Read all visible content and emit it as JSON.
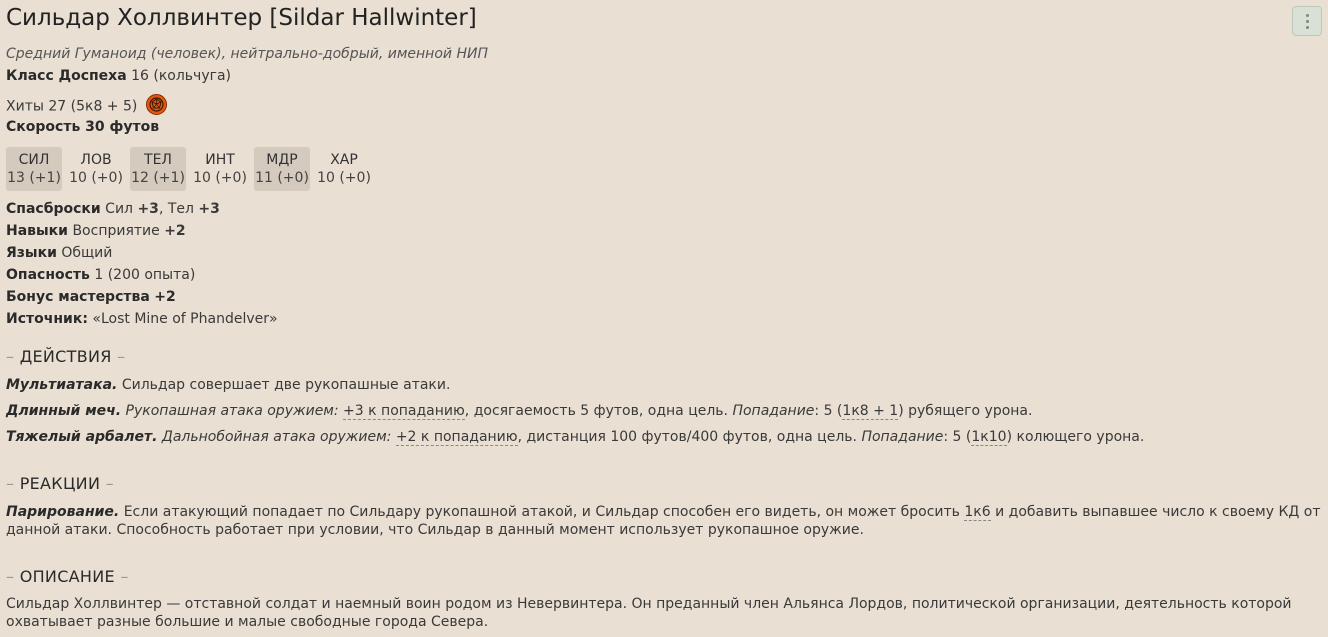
{
  "header": {
    "title": "Сильдар Холлвинтер [Sildar Hallwinter]"
  },
  "creature": {
    "subtitle": "Средний Гуманоид (человек), нейтрально-добрый, именной НИП",
    "ac_label": "Класс Доспеха",
    "ac_value": "16 (кольчуга)",
    "hp_label": "Хиты",
    "hp_value": "27 (5к8 + 5)",
    "speed_label": "Скорость 30 футов"
  },
  "stats": [
    {
      "ab": "СИЛ",
      "val": "13 (+1)",
      "highlight": true
    },
    {
      "ab": "ЛОВ",
      "val": "10 (+0)",
      "highlight": false
    },
    {
      "ab": "ТЕЛ",
      "val": "12 (+1)",
      "highlight": true
    },
    {
      "ab": "ИНТ",
      "val": "10 (+0)",
      "highlight": false
    },
    {
      "ab": "МДР",
      "val": "11 (+0)",
      "highlight": true
    },
    {
      "ab": "ХАР",
      "val": "10 (+0)",
      "highlight": false
    }
  ],
  "props": {
    "saves_label": "Спасброски",
    "saves_1": "Сил",
    "saves_1_val": "+3",
    "saves_sep": ", Тел",
    "saves_2_val": "+3",
    "skills_label": "Навыки",
    "skills_value": "Восприятие",
    "skills_val": "+2",
    "lang_label": "Языки",
    "lang_value": "Общий",
    "danger_label": "Опасность",
    "danger_value": "1 (200 опыта)",
    "prof_label": "Бонус мастерства",
    "prof_value": "+2",
    "source_label": "Источник:",
    "source_value": "«Lost Mine of Phandelver»"
  },
  "actions": {
    "heading": "ДЕЙСТВИЯ",
    "multi_name": "Мультиатака.",
    "multi_text": "Сильдар совершает две рукопашные атаки.",
    "sword_name": "Длинный меч.",
    "sword_type": "Рукопашная атака оружием:",
    "sword_hit": "+3 к попаданию",
    "sword_mid": ", досягаемость 5 футов, одна цель.",
    "sword_hitlabel": "Попадание",
    "sword_dmg_pre": ": 5 (",
    "sword_dice": "1к8 + 1",
    "sword_dmg_post": ") рубящего урона.",
    "xbow_name": "Тяжелый арбалет.",
    "xbow_type": "Дальнобойная атака оружием:",
    "xbow_hit": "+2 к попаданию",
    "xbow_mid": ", дистанция 100 футов/400 футов, одна цель.",
    "xbow_hitlabel": "Попадание",
    "xbow_dmg_pre": ": 5 (",
    "xbow_dice": "1к10",
    "xbow_dmg_post": ") колющего урона."
  },
  "reactions": {
    "heading": "РЕАКЦИИ",
    "parry_name": "Парирование.",
    "parry_text1": "Если атакующий попадает по Сильдару рукопашной атакой, и Сильдар способен его видеть, он может бросить",
    "parry_dice": "1к6",
    "parry_text2": "и добавить выпавшее число к своему КД от данной атаки. Способность работает при условии, что Сильдар в данный момент использует рукопашное оружие."
  },
  "description": {
    "heading": "ОПИСАНИЕ",
    "text": "Сильдар Холлвинтер — отставной солдат и наемный воин родом из Невервинтера. Он преданный член Альянса Лордов, политической организации, деятельность которой охватывает разные большие и малые свободные города Севера."
  },
  "dash": "–",
  "icons": {
    "menu": "kebab-menu-icon",
    "dice": "dice-roll-icon"
  },
  "colors": {
    "background": "#e9dfd2",
    "stat_highlight": "#d4cabd",
    "dice": "#e05a10"
  }
}
